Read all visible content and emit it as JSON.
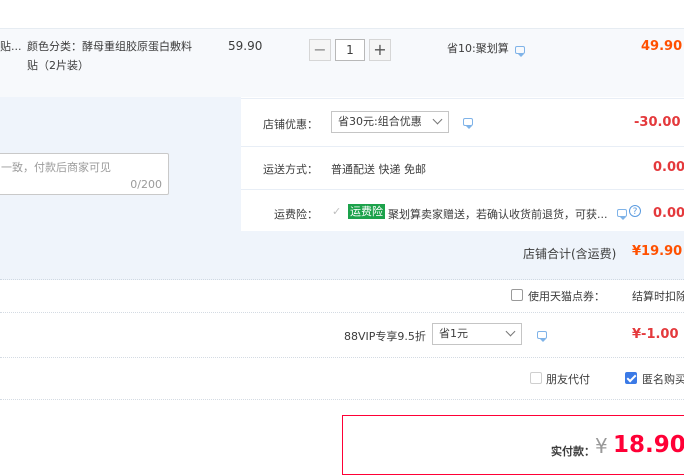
{
  "product": {
    "name_fragment": "贴...",
    "spec_line1": "颜色分类：酵母重组胶原蛋白敷料",
    "spec_line2": "贴（2片装）",
    "unit_price": "59.90",
    "qty_minus": "−",
    "qty_value": "1",
    "qty_plus": "+",
    "promo": "省10:聚划算",
    "subtotal": "49.90"
  },
  "message": {
    "placeholder": "一致，付款后商家可见",
    "counter": "0/200"
  },
  "store_discount": {
    "label": "店铺优惠：",
    "selected": "省30元:组合优惠",
    "amount": "-30.00"
  },
  "shipping": {
    "label": "运送方式：",
    "value": "普通配送 快递 免邮",
    "amount": "0.00"
  },
  "insurance": {
    "label": "运费险：",
    "badge": "运费险",
    "text": "聚划算卖家赠送，若确认收货前退货，可获...",
    "help": "?",
    "amount": "0.00"
  },
  "store_total": {
    "label": "店铺合计(含运费)",
    "amount": "¥19.90"
  },
  "points": {
    "label": "使用天猫点券：",
    "note": "结算时扣除"
  },
  "vip": {
    "label": "88VIP专享9.5折",
    "selected": "省1元",
    "amount": "¥-1.00"
  },
  "options": {
    "friend_pay": "朋友代付",
    "anonymous": "匿名购买"
  },
  "payment": {
    "label": "实付款：",
    "currency": "¥",
    "amount": "18.90"
  },
  "colors": {
    "accent_red": "#e4393c",
    "orange": "#ff5000",
    "checkbox_blue": "#3b7ae6",
    "badge_green": "#1ca24b"
  }
}
